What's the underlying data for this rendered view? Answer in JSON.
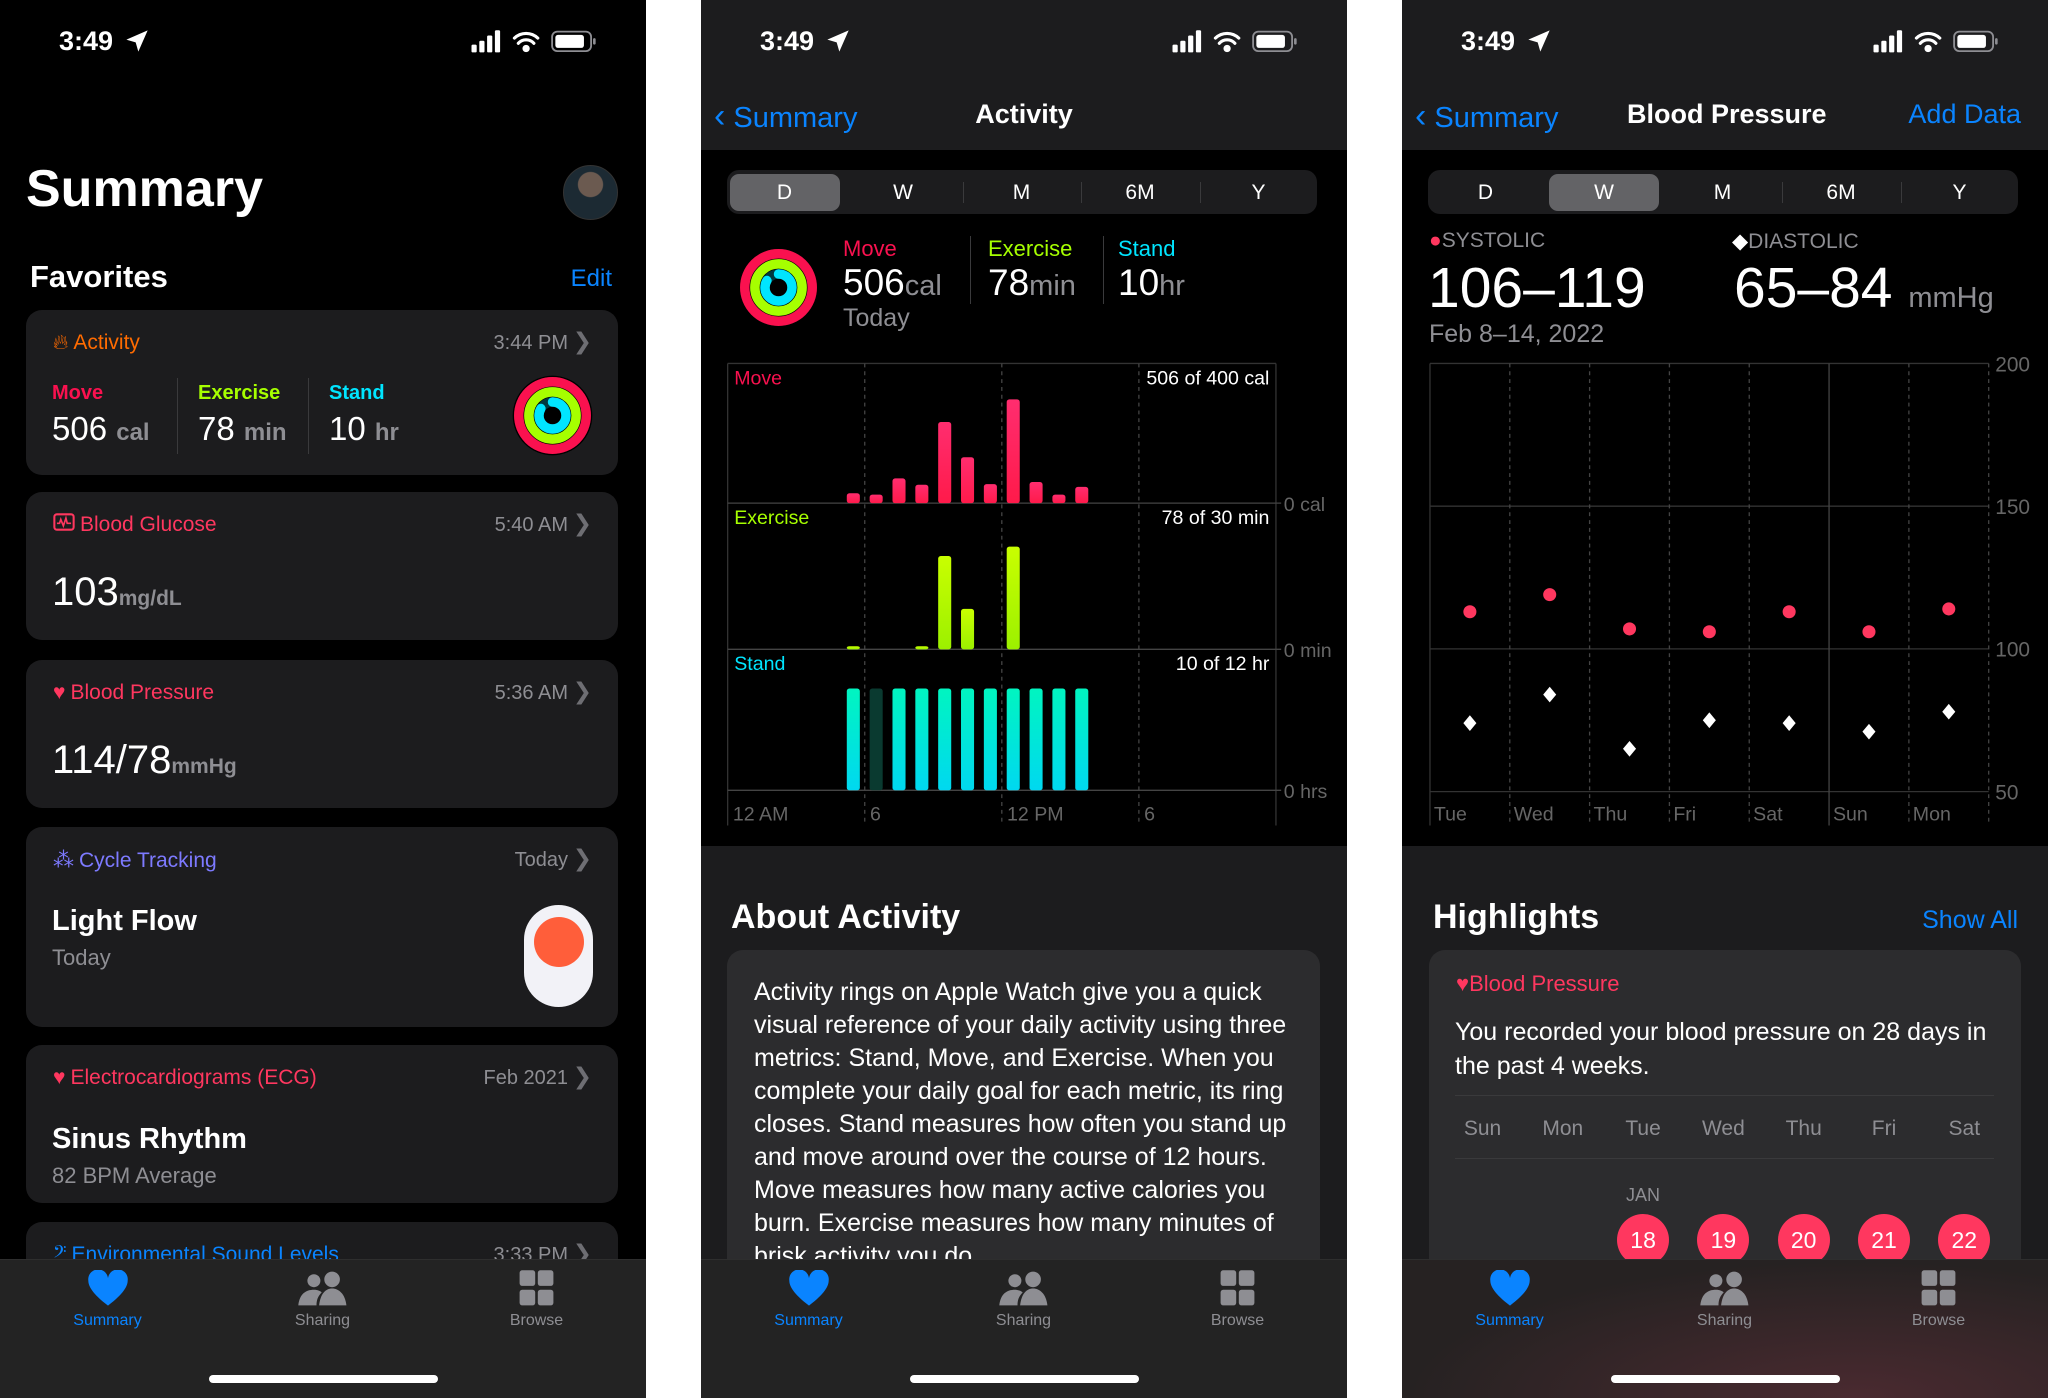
{
  "status": {
    "time": "3:49"
  },
  "colors": {
    "move": "#fa114f",
    "exercise": "#a6ff00",
    "stand": "#00e5ff",
    "blue": "#0a84ff",
    "bp": "#ff375f",
    "activity": "#ff6b00",
    "cycle": "#7d7aff"
  },
  "summary": {
    "title": "Summary",
    "favorites": "Favorites",
    "edit": "Edit",
    "activity": {
      "title": "Activity",
      "time": "3:44 PM",
      "move_label": "Move",
      "move_value": "506",
      "move_unit": "cal",
      "exercise_label": "Exercise",
      "exercise_value": "78",
      "exercise_unit": "min",
      "stand_label": "Stand",
      "stand_value": "10",
      "stand_unit": "hr"
    },
    "glucose": {
      "title": "Blood Glucose",
      "time": "5:40 AM",
      "value": "103",
      "unit": "mg/dL"
    },
    "bp": {
      "title": "Blood Pressure",
      "time": "5:36 AM",
      "value": "114/78",
      "unit": "mmHg"
    },
    "cycle": {
      "title": "Cycle Tracking",
      "time": "Today",
      "value": "Light Flow",
      "sub": "Today"
    },
    "ecg": {
      "title": "Electrocardiograms (ECG)",
      "time": "Feb 2021",
      "value": "Sinus Rhythm",
      "sub": "82 BPM Average"
    },
    "sound": {
      "title": "Environmental Sound Levels",
      "time": "3:33 PM"
    }
  },
  "tabs": [
    "Summary",
    "Sharing",
    "Browse"
  ],
  "activity": {
    "back": "Summary",
    "title": "Activity",
    "segments": [
      "D",
      "W",
      "M",
      "6M",
      "Y"
    ],
    "selected": "D",
    "move_label": "Move",
    "move_value": "506",
    "move_unit": "cal",
    "today": "Today",
    "exercise_label": "Exercise",
    "exercise_value": "78",
    "exercise_unit": "min",
    "stand_label": "Stand",
    "stand_value": "10",
    "stand_unit": "hr",
    "about_title": "About Activity",
    "about_text": "Activity rings on Apple Watch give you a quick visual reference of your daily activity using three metrics: Stand, Move, and Exercise. When you complete your daily goal for each metric, its ring closes. Stand measures how often you stand up and move around over the course of 12 hours. Move measures how many active calories you burn. Exercise measures how many minutes of brisk activity you do"
  },
  "bp": {
    "back": "Summary",
    "title": "Blood Pressure",
    "add": "Add Data",
    "segments": [
      "D",
      "W",
      "M",
      "6M",
      "Y"
    ],
    "selected": "W",
    "systolic_label": "SYSTOLIC",
    "systolic_range": "106–119",
    "diastolic_label": "DIASTOLIC",
    "diastolic_range": "65–84",
    "unit": "mmHg",
    "date_range": "Feb 8–14, 2022",
    "highlights": "Highlights",
    "show_all": "Show All",
    "hl_title": "Blood Pressure",
    "hl_text": "You recorded your blood pressure on 28 days in the past 4 weeks.",
    "week_days": [
      "Sun",
      "Mon",
      "Tue",
      "Wed",
      "Thu",
      "Fri",
      "Sat"
    ],
    "month": "JAN",
    "dates": [
      "18",
      "19",
      "20",
      "21",
      "22"
    ]
  },
  "chart_data": [
    {
      "type": "bar",
      "panel": "Move",
      "summary": "506 of 400 cal",
      "unit_label": "0 cal",
      "x_hours": [
        5,
        6,
        7,
        8,
        9,
        10,
        11,
        12,
        13,
        14,
        15
      ],
      "values": [
        14,
        12,
        35,
        26,
        115,
        65,
        27,
        147,
        30,
        12,
        23
      ],
      "ymax": 198,
      "x_ticks": [
        "12 AM",
        "6",
        "12 PM",
        "6"
      ]
    },
    {
      "type": "bar",
      "panel": "Exercise",
      "summary": "78 of 30 min",
      "unit_label": "0 min",
      "x_hours": [
        5,
        8,
        9,
        10,
        12
      ],
      "values": [
        1,
        1,
        30,
        13,
        33
      ],
      "ymax": 47
    },
    {
      "type": "bar",
      "panel": "Stand",
      "summary": "10 of 12 hr",
      "unit_label": "0 hrs",
      "x_hours": [
        5,
        6,
        7,
        8,
        9,
        10,
        11,
        12,
        13,
        14,
        15
      ],
      "values": [
        1,
        0,
        1,
        1,
        1,
        1,
        1,
        1,
        1,
        1,
        1
      ]
    },
    {
      "type": "scatter",
      "categories": [
        "Tue",
        "Wed",
        "Thu",
        "Fri",
        "Sat",
        "Sun",
        "Mon"
      ],
      "series": [
        {
          "name": "SYSTOLIC",
          "values": [
            113,
            119,
            107,
            106,
            113,
            106,
            114
          ],
          "color": "#ff375f",
          "marker": "circle"
        },
        {
          "name": "DIASTOLIC",
          "values": [
            74,
            84,
            65,
            75,
            74,
            71,
            78
          ],
          "color": "#ffffff",
          "marker": "diamond"
        }
      ],
      "ylim": [
        50,
        200
      ],
      "y_ticks": [
        50,
        100,
        150,
        200
      ],
      "grid": true
    }
  ]
}
